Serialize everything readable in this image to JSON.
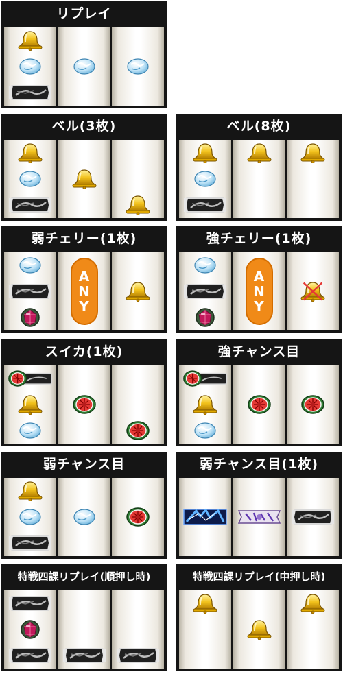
{
  "panels": [
    {
      "title": "リプレイ",
      "reels": [
        [
          "bell",
          "replay",
          "bar"
        ],
        [
          null,
          "replay",
          null
        ],
        [
          null,
          "replay",
          null
        ]
      ]
    },
    {
      "title": "ベル(3枚)",
      "reels": [
        [
          "bell",
          "replay",
          "bar"
        ],
        [
          null,
          "bell",
          null
        ],
        [
          null,
          null,
          "bell"
        ]
      ]
    },
    {
      "title": "ベル(8枚)",
      "reels": [
        [
          "bell",
          "replay",
          "bar"
        ],
        [
          "bell",
          null,
          null
        ],
        [
          "bell",
          null,
          null
        ]
      ]
    },
    {
      "title": "弱チェリー(1枚)",
      "reels": [
        [
          "replay",
          "bar",
          "jewel"
        ],
        "any",
        [
          null,
          "bell",
          null
        ]
      ]
    },
    {
      "title": "強チェリー(1枚)",
      "reels": [
        [
          "replay",
          "bar",
          "jewel"
        ],
        "any",
        [
          null,
          "bell-x",
          null
        ]
      ]
    },
    {
      "title": "スイカ(1枚)",
      "reels": [
        [
          "melon-bar",
          "bell",
          "replay"
        ],
        [
          null,
          "melon",
          null
        ],
        [
          null,
          null,
          "melon"
        ]
      ]
    },
    {
      "title": "強チャンス目",
      "reels": [
        [
          "melon-bar",
          "bell",
          "replay"
        ],
        [
          null,
          "melon",
          null
        ],
        [
          null,
          "melon",
          null
        ]
      ]
    },
    {
      "title": "弱チャンス目",
      "reels": [
        [
          "bell",
          "replay",
          "bar"
        ],
        [
          null,
          "replay",
          null
        ],
        [
          null,
          "melon",
          null
        ]
      ]
    },
    {
      "title": "弱チャンス目(1枚)",
      "reels": [
        [
          null,
          "blue",
          null
        ],
        [
          null,
          "purple",
          null
        ],
        [
          null,
          "bar",
          null
        ]
      ]
    },
    {
      "title": "特戦四課リプレイ(順押し時)",
      "reels": [
        [
          "bar",
          "jewel",
          "bar"
        ],
        [
          null,
          null,
          "bar"
        ],
        [
          null,
          null,
          "bar"
        ]
      ]
    },
    {
      "title": "特戦四課リプレイ(中押し時)",
      "reels": [
        [
          "bell",
          null,
          null
        ],
        [
          null,
          "bell",
          null
        ],
        [
          "bell",
          null,
          null
        ]
      ]
    }
  ],
  "any_label": [
    "A",
    "N",
    "Y"
  ],
  "colors": {
    "panel_bg": "#151515",
    "title_text": "#ffffff",
    "any_orange": "#f08a18",
    "bell_gold": "#f2c21c"
  }
}
